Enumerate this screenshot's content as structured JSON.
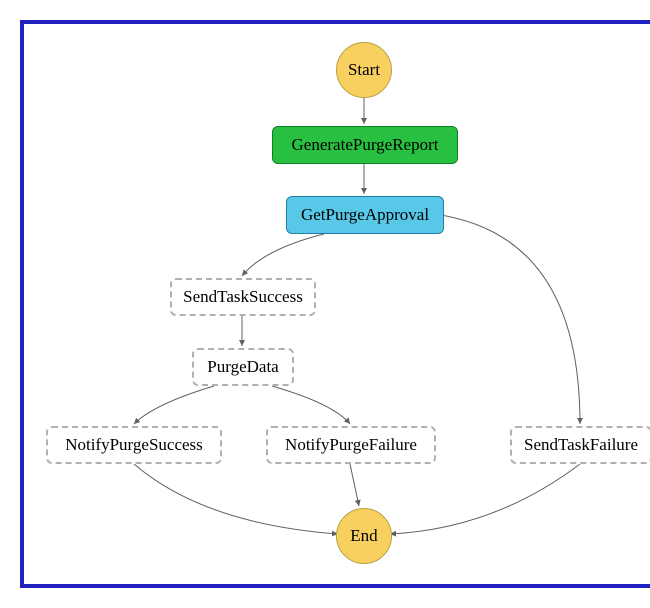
{
  "nodes": {
    "start": "Start",
    "generate": "GeneratePurgeReport",
    "approval": "GetPurgeApproval",
    "sendSuccess": "SendTaskSuccess",
    "purgeData": "PurgeData",
    "notifySuccess": "NotifyPurgeSuccess",
    "notifyFailure": "NotifyPurgeFailure",
    "sendFailure": "SendTaskFailure",
    "end": "End"
  },
  "flow": {
    "edges": [
      [
        "start",
        "generate"
      ],
      [
        "generate",
        "approval"
      ],
      [
        "approval",
        "sendSuccess"
      ],
      [
        "approval",
        "sendFailure"
      ],
      [
        "sendSuccess",
        "purgeData"
      ],
      [
        "purgeData",
        "notifySuccess"
      ],
      [
        "purgeData",
        "notifyFailure"
      ],
      [
        "notifySuccess",
        "end"
      ],
      [
        "notifyFailure",
        "end"
      ],
      [
        "sendFailure",
        "end"
      ]
    ]
  }
}
